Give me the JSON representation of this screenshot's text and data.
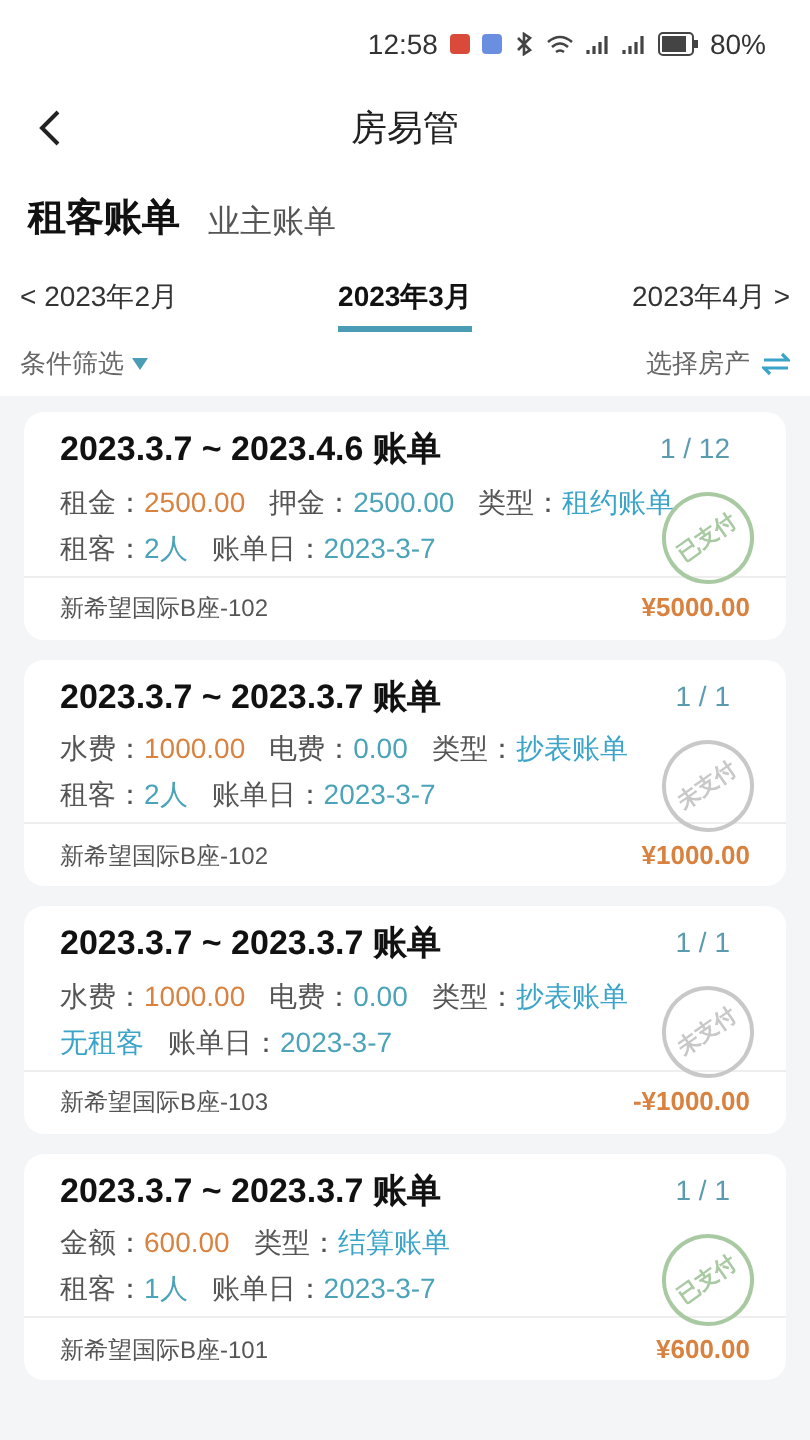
{
  "status_bar": {
    "time": "12:58",
    "battery": "80%"
  },
  "header": {
    "title": "房易管"
  },
  "tabs": [
    {
      "label": "租客账单",
      "selected": true
    },
    {
      "label": "业主账单",
      "selected": false
    }
  ],
  "months": [
    {
      "label": "< 2023年2月",
      "selected": false
    },
    {
      "label": "2023年3月",
      "selected": true
    },
    {
      "label": "2023年4月 >",
      "selected": false
    }
  ],
  "filters": {
    "left": "条件筛选",
    "right": "选择房产"
  },
  "bills": [
    {
      "title": "2023.3.7 ~ 2023.4.6 账单",
      "count": "1 / 12",
      "lines": [
        [
          {
            "label": "租金：",
            "value": "2500.00",
            "color": "#d9823f"
          },
          {
            "label": "押金：",
            "value": "2500.00",
            "color": "#4aa3b8"
          },
          {
            "label": "类型：",
            "value": "租约账单",
            "color": "#3ba4c9"
          }
        ],
        [
          {
            "label": "租客：",
            "value": "2人",
            "color": "#4aa3b8"
          },
          {
            "label": "账单日：",
            "value": "2023-3-7",
            "color": "#4aa3b8"
          }
        ]
      ],
      "stamp": {
        "text": "已支付",
        "paid": true
      },
      "property": "新希望国际B座-102",
      "total": "¥5000.00"
    },
    {
      "title": "2023.3.7 ~ 2023.3.7 账单",
      "count": "1 / 1",
      "lines": [
        [
          {
            "label": "水费：",
            "value": "1000.00",
            "color": "#d9823f"
          },
          {
            "label": "电费：",
            "value": "0.00",
            "color": "#4aa3b8"
          },
          {
            "label": "类型：",
            "value": "抄表账单",
            "color": "#3ba4c9"
          }
        ],
        [
          {
            "label": "租客：",
            "value": "2人",
            "color": "#4aa3b8"
          },
          {
            "label": "账单日：",
            "value": "2023-3-7",
            "color": "#4aa3b8"
          }
        ]
      ],
      "stamp": {
        "text": "未支付",
        "paid": false
      },
      "property": "新希望国际B座-102",
      "total": "¥1000.00"
    },
    {
      "title": "2023.3.7 ~ 2023.3.7 账单",
      "count": "1 / 1",
      "lines": [
        [
          {
            "label": "水费：",
            "value": "1000.00",
            "color": "#d9823f"
          },
          {
            "label": "电费：",
            "value": "0.00",
            "color": "#4aa3b8"
          },
          {
            "label": "类型：",
            "value": "抄表账单",
            "color": "#3ba4c9"
          }
        ],
        [
          {
            "value": "无租客",
            "color": "#3ba4c9"
          },
          {
            "label": "账单日：",
            "value": "2023-3-7",
            "color": "#4aa3b8"
          }
        ]
      ],
      "stamp": {
        "text": "未支付",
        "paid": false
      },
      "property": "新希望国际B座-103",
      "total": "-¥1000.00"
    },
    {
      "title": "2023.3.7 ~ 2023.3.7 账单",
      "count": "1 / 1",
      "lines": [
        [
          {
            "label": "金额：",
            "value": "600.00",
            "color": "#d9823f"
          },
          {
            "label": "类型：",
            "value": "结算账单",
            "color": "#3ba4c9"
          }
        ],
        [
          {
            "label": "租客：",
            "value": "1人",
            "color": "#4aa3b8"
          },
          {
            "label": "账单日：",
            "value": "2023-3-7",
            "color": "#4aa3b8"
          }
        ]
      ],
      "stamp": {
        "text": "已支付",
        "paid": true
      },
      "property": "新希望国际B座-101",
      "total": "¥600.00"
    }
  ]
}
